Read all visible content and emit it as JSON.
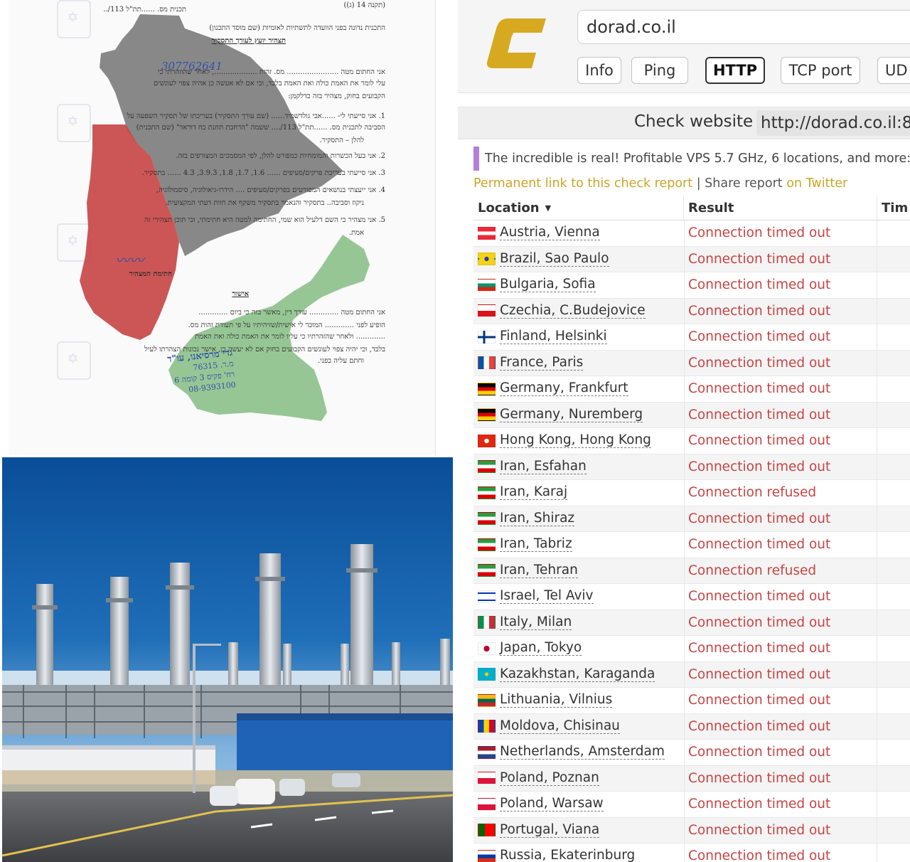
{
  "document": {
    "header_ref": "(תקנה 14 (ג))",
    "plan_line": "תכנית מס.  ......תת\"ל 113/..",
    "committee_line": "התכנית נדונה בפני  הוועדה לתשתיות לאומיות (שם מוסד התכנון)",
    "section_title": "תצהיר יועץ לעורך התסקיר",
    "paragraph_lines": [
      "אני החתום מטה ....................... מס. זהות  ..................., לאחר שהוזהרתי כי",
      "עלי לומר את האמת כולה ואת האמת בלבד, וכי אם לא אעשה כן אהיה צפוי לעונשים",
      "הקבועים בחוק, מצהיר בזה כדלקמן:",
      "1.  אני סייעתי לי- ......אבי גולדשמיד...... (שם עורך התסקיר) בעריכתו של תסקיר השפעה על",
      "הסביבה לתכנית מס. ......תת\"ל 113/.... ששמה \"הרחבת תחנת כח דוראד\" (שם התכנית)",
      "להלן – התסקיר.",
      "2.  אני בעל הכשרות והמומחיות כמפורט להלן, לפי המסמכים המצורפים בזה.",
      "3.  אני סייעתי בעריכת פרקים/סעיפים ...... 1.6, 1.7, 1.8, 3.9.3, 4.3 ...... בתסקיר.",
      "4.  אני ייעצתי בנושאים המפורטים בפרקים/סעיפים .... הידרו-גיאולוגיה, סיסמולוגיה,",
      "ניקוז וסביבה.. בתסקיר והנאמר בתסקיר משקף את חוות דעתי המקצועית.",
      "5.  אני מצהיר כי השם דלעיל הוא שמי, החתימה למטה היא חתימתי, וכי תוכן תצהירי זה",
      "אמת."
    ],
    "signature_caption": "חתימת המצהיר",
    "approval_title": "אישור",
    "approval_lines": [
      "אני החתום מטה ............. עורך דין, מאשר בזה כי ביום .............",
      "הופיע לפני ............. המוכר לי אישית/שזיהיתיו על פי תעודת זהות מס.",
      "............. ולאחר שהזהרתיו כי עליו לומר את האמת כולה ואת האמת",
      "בלבד, וכי יהיה צפוי לעונשים הקבועים בחוק אם לא יעשה כן, אישר נכונות הצהרתו לעיל",
      "וחתם עליה בפני."
    ],
    "handwritten_id": "307762641",
    "stamp_lines": [
      "גדי מרסיאנו, עו\"ד",
      "מ.ר. 76315",
      "רח' פקיס 3 קומה 6",
      "08-9393100"
    ]
  },
  "checker": {
    "url_value": "dorad.co.il",
    "buttons": [
      {
        "label": "Info",
        "active": false
      },
      {
        "label": "Ping",
        "active": false
      },
      {
        "label": "HTTP",
        "active": true
      },
      {
        "label": "TCP port",
        "active": false
      },
      {
        "label": "UD",
        "active": false
      }
    ],
    "check_label": "Check website",
    "check_url": "http://dorad.co.il:8",
    "promo_text": "The incredible is real! Profitable VPS 5.7 GHz, 6 locations, and more:",
    "permanent_link": "Permanent link to this check report",
    "separator": " | ",
    "share_text": "Share report ",
    "share_link": "on Twitter",
    "columns": {
      "location": "Location",
      "result": "Result",
      "time": "Tim"
    },
    "rows": [
      {
        "location": "Austria, Vienna",
        "result": "Connection timed out",
        "flag": "at"
      },
      {
        "location": "Brazil, Sao Paulo",
        "result": "Connection timed out",
        "flag": "br"
      },
      {
        "location": "Bulgaria, Sofia",
        "result": "Connection timed out",
        "flag": "bg"
      },
      {
        "location": "Czechia, C.Budejovice",
        "result": "Connection timed out",
        "flag": "cz"
      },
      {
        "location": "Finland, Helsinki",
        "result": "Connection timed out",
        "flag": "fi"
      },
      {
        "location": "France, Paris",
        "result": "Connection timed out",
        "flag": "fr"
      },
      {
        "location": "Germany, Frankfurt",
        "result": "Connection timed out",
        "flag": "de"
      },
      {
        "location": "Germany, Nuremberg",
        "result": "Connection timed out",
        "flag": "de"
      },
      {
        "location": "Hong Kong, Hong Kong",
        "result": "Connection timed out",
        "flag": "hk"
      },
      {
        "location": "Iran, Esfahan",
        "result": "Connection timed out",
        "flag": "ir"
      },
      {
        "location": "Iran, Karaj",
        "result": "Connection refused",
        "flag": "ir"
      },
      {
        "location": "Iran, Shiraz",
        "result": "Connection timed out",
        "flag": "ir"
      },
      {
        "location": "Iran, Tabriz",
        "result": "Connection timed out",
        "flag": "ir"
      },
      {
        "location": "Iran, Tehran",
        "result": "Connection refused",
        "flag": "ir"
      },
      {
        "location": "Israel, Tel Aviv",
        "result": "Connection timed out",
        "flag": "il"
      },
      {
        "location": "Italy, Milan",
        "result": "Connection timed out",
        "flag": "it"
      },
      {
        "location": "Japan, Tokyo",
        "result": "Connection timed out",
        "flag": "jp"
      },
      {
        "location": "Kazakhstan, Karaganda",
        "result": "Connection timed out",
        "flag": "kz"
      },
      {
        "location": "Lithuania, Vilnius",
        "result": "Connection timed out",
        "flag": "lt"
      },
      {
        "location": "Moldova, Chisinau",
        "result": "Connection timed out",
        "flag": "md"
      },
      {
        "location": "Netherlands, Amsterdam",
        "result": "Connection timed out",
        "flag": "nl"
      },
      {
        "location": "Poland, Poznan",
        "result": "Connection timed out",
        "flag": "pl"
      },
      {
        "location": "Poland, Warsaw",
        "result": "Connection timed out",
        "flag": "pl"
      },
      {
        "location": "Portugal, Viana",
        "result": "Connection timed out",
        "flag": "pt"
      },
      {
        "location": "Russia, Ekaterinburg",
        "result": "Connection timed out",
        "flag": "ru"
      }
    ]
  },
  "colors": {
    "map_gray": "#7b7b7b",
    "map_red": "#c84848",
    "map_green": "#8cc08a",
    "result_red": "#c74444",
    "link_yellow": "#caa528",
    "logo_gold": "#d6a920",
    "promo_purple": "#b480d8"
  }
}
